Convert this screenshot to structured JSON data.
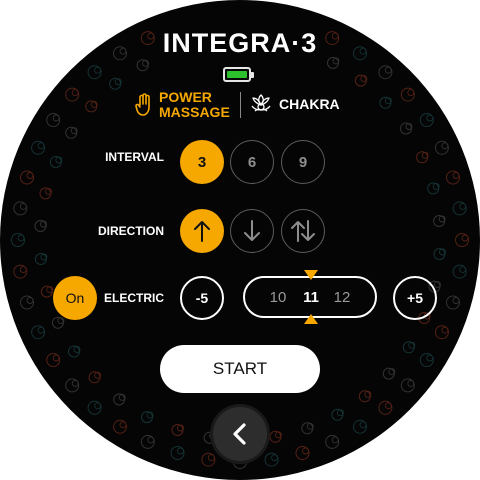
{
  "app": {
    "title": "INTEGRA·3",
    "battery": {
      "level": 1.0,
      "icon": "battery-icon"
    },
    "modes": [
      {
        "label": "POWER\nMASSAGE",
        "line1": "POWER",
        "line2": "MASSAGE",
        "icon": "hand-icon",
        "active": true
      },
      {
        "label": "CHAKRA",
        "icon": "lotus-icon",
        "active": false
      }
    ]
  },
  "interval": {
    "label": "INTERVAL",
    "options": [
      "3",
      "6",
      "9"
    ],
    "selected": "3"
  },
  "direction": {
    "label": "DIRECTION",
    "options": [
      {
        "glyph": "↑",
        "name": "up"
      },
      {
        "glyph": "↓",
        "name": "down"
      },
      {
        "glyph": "⇅",
        "name": "both"
      }
    ],
    "selected": "up"
  },
  "electric": {
    "toggle_label": "On",
    "label": "ELECTRIC",
    "decrease_label": "-5",
    "increase_label": "+5",
    "values": [
      "10",
      "11",
      "12"
    ],
    "current": "11"
  },
  "start_label": "START",
  "colors": {
    "accent": "#f6a800",
    "background": "#050505",
    "ring_orange": "#b4442a",
    "ring_teal": "#2a6a70"
  }
}
